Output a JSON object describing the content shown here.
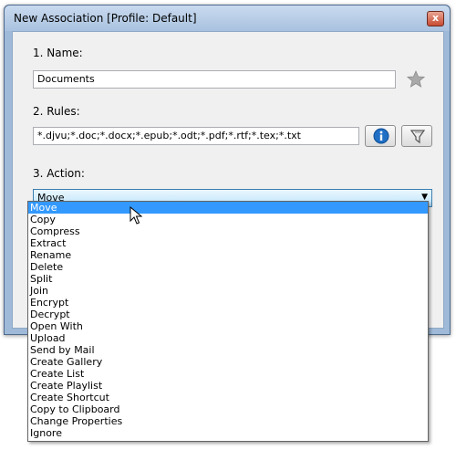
{
  "window": {
    "title": "New Association [Profile: Default]",
    "close_glyph": "x"
  },
  "name_section": {
    "label": "1. Name:",
    "value": "Documents",
    "favorite_icon": "star-icon"
  },
  "rules_section": {
    "label": "2. Rules:",
    "value": "*.djvu;*.doc;*.docx;*.epub;*.odt;*.pdf;*.rtf;*.tex;*.txt",
    "info_icon": "info-icon",
    "filter_icon": "filter-icon"
  },
  "action_section": {
    "label": "3. Action:",
    "selected": "Move",
    "options": [
      "Move",
      "Copy",
      "Compress",
      "Extract",
      "Rename",
      "Delete",
      "Split",
      "Join",
      "Encrypt",
      "Decrypt",
      "Open With",
      "Upload",
      "Send by Mail",
      "Create Gallery",
      "Create List",
      "Create Playlist",
      "Create Shortcut",
      "Copy to Clipboard",
      "Change Properties",
      "Ignore"
    ],
    "highlighted_index": 0
  },
  "colors": {
    "selection": "#3399ff",
    "frame": "#9fbad8",
    "client": "#f0f0f0"
  }
}
